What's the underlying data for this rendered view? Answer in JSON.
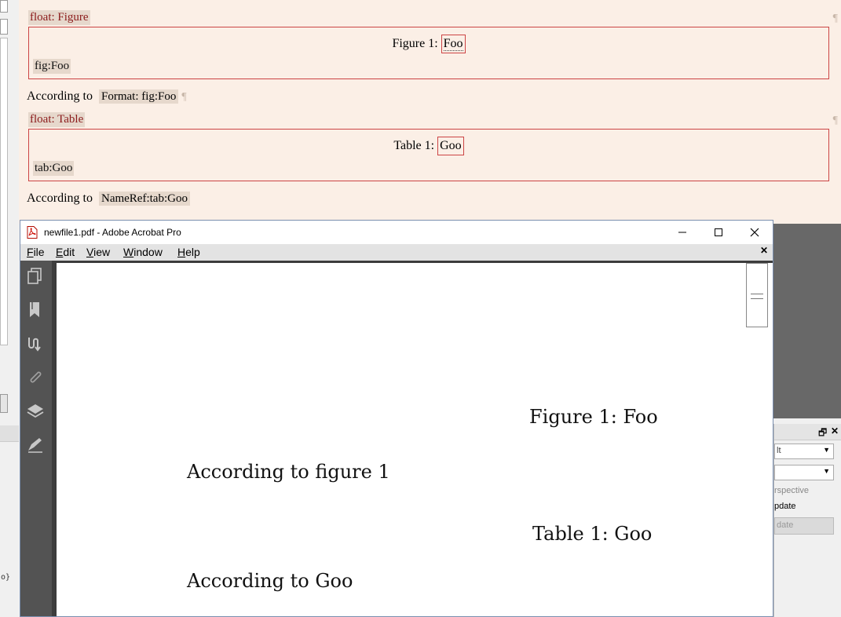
{
  "lyx": {
    "float_figure": {
      "label": "float: Figure",
      "caption_prefix": "Figure 1:",
      "caption_text": "Foo",
      "label_inset": "fig:Foo"
    },
    "para1": {
      "text": "According to",
      "ref": "Format: fig:Foo"
    },
    "float_table": {
      "label": "float: Table",
      "caption_prefix": "Table 1:",
      "caption_text": "Goo",
      "label_inset": "tab:Goo"
    },
    "para2": {
      "text": "According to",
      "ref": "NameRef:tab:Goo"
    },
    "pilcrow": "¶",
    "left_fragment": "o}",
    "right_panel": {
      "combo1": "lt",
      "combo2": "",
      "text1": "rspective",
      "text2": "pdate",
      "button": "date"
    }
  },
  "acrobat": {
    "title": "newfile1.pdf - Adobe Acrobat Pro",
    "menu": [
      {
        "accel": "F",
        "rest": "ile"
      },
      {
        "accel": "E",
        "rest": "dit"
      },
      {
        "accel": "V",
        "rest": "iew"
      },
      {
        "accel": "W",
        "rest": "indow"
      },
      {
        "accel": "H",
        "rest": "elp"
      }
    ],
    "sidebar_icons": [
      "pages-icon",
      "bookmark-icon",
      "signature-icon",
      "attachment-icon",
      "layers-icon",
      "edit-sign-icon"
    ],
    "pdf": {
      "figure_caption": "Figure 1:  Foo",
      "para1": "According to figure 1",
      "table_caption": "Table 1:  Goo",
      "para2": "According to Goo"
    }
  }
}
